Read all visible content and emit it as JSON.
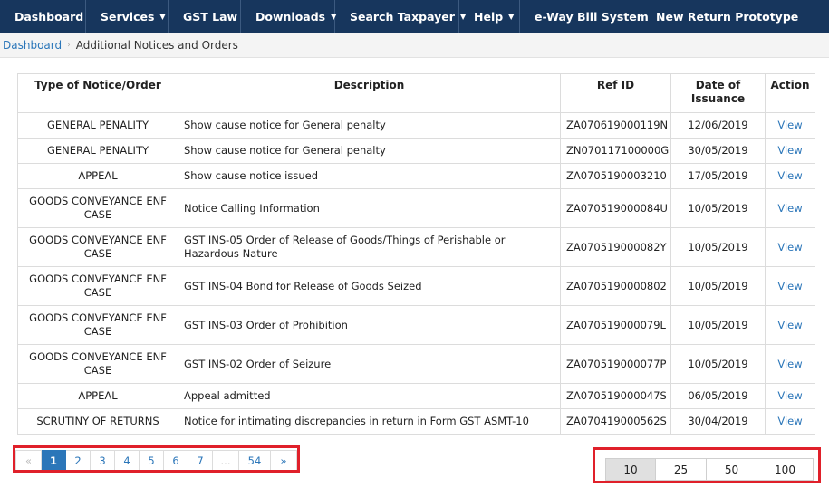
{
  "nav": {
    "items": [
      {
        "label": "Dashboard",
        "caret": ""
      },
      {
        "label": "Services",
        "caret": "▼"
      },
      {
        "label": "GST Law",
        "caret": ""
      },
      {
        "label": "Downloads",
        "caret": "▼"
      },
      {
        "label": "Search Taxpayer",
        "caret": "▼"
      },
      {
        "label": "Help",
        "caret": "▼"
      },
      {
        "label": "e-Way Bill System",
        "caret": ""
      },
      {
        "label": "New Return Prototype",
        "caret": ""
      }
    ]
  },
  "breadcrumb": {
    "home": "Dashboard",
    "separator": "›",
    "current": "Additional Notices and Orders"
  },
  "table": {
    "headers": {
      "type": "Type of Notice/Order",
      "description": "Description",
      "ref_id": "Ref ID",
      "date": "Date of Issuance",
      "action": "Action"
    },
    "rows": [
      {
        "type": "GENERAL PENALITY",
        "description": "Show cause notice for General penalty",
        "ref_id": "ZA070619000119N",
        "date": "12/06/2019",
        "action": "View"
      },
      {
        "type": "GENERAL PENALITY",
        "description": "Show cause notice for General penalty",
        "ref_id": "ZN070117100000G",
        "date": "30/05/2019",
        "action": "View"
      },
      {
        "type": "APPEAL",
        "description": "Show cause notice issued",
        "ref_id": "ZA0705190003210",
        "date": "17/05/2019",
        "action": "View"
      },
      {
        "type": "GOODS CONVEYANCE ENF CASE",
        "description": "Notice Calling Information",
        "ref_id": "ZA070519000084U",
        "date": "10/05/2019",
        "action": "View"
      },
      {
        "type": "GOODS CONVEYANCE ENF CASE",
        "description": "GST INS-05 Order of Release of Goods/Things of Perishable or Hazardous Nature",
        "ref_id": "ZA070519000082Y",
        "date": "10/05/2019",
        "action": "View"
      },
      {
        "type": "GOODS CONVEYANCE ENF CASE",
        "description": "GST INS-04 Bond for Release of Goods Seized",
        "ref_id": "ZA0705190000802",
        "date": "10/05/2019",
        "action": "View"
      },
      {
        "type": "GOODS CONVEYANCE ENF CASE",
        "description": "GST INS-03 Order of Prohibition",
        "ref_id": "ZA070519000079L",
        "date": "10/05/2019",
        "action": "View"
      },
      {
        "type": "GOODS CONVEYANCE ENF CASE",
        "description": "GST INS-02 Order of Seizure",
        "ref_id": "ZA070519000077P",
        "date": "10/05/2019",
        "action": "View"
      },
      {
        "type": "APPEAL",
        "description": "Appeal admitted",
        "ref_id": "ZA070519000047S",
        "date": "06/05/2019",
        "action": "View"
      },
      {
        "type": "SCRUTINY OF RETURNS",
        "description": "Notice for intimating discrepancies in return in Form GST ASMT-10",
        "ref_id": "ZA070419000562S",
        "date": "30/04/2019",
        "action": "View"
      }
    ]
  },
  "pagination": {
    "prev": "«",
    "pages": [
      "1",
      "2",
      "3",
      "4",
      "5",
      "6",
      "7",
      "...",
      "54"
    ],
    "next": "»",
    "current_page": "1"
  },
  "page_size": {
    "options": [
      "10",
      "25",
      "50",
      "100"
    ],
    "selected": "10"
  },
  "colors": {
    "nav_background": "#17365d",
    "link": "#2b76b9",
    "highlight_box": "#e0202a"
  }
}
